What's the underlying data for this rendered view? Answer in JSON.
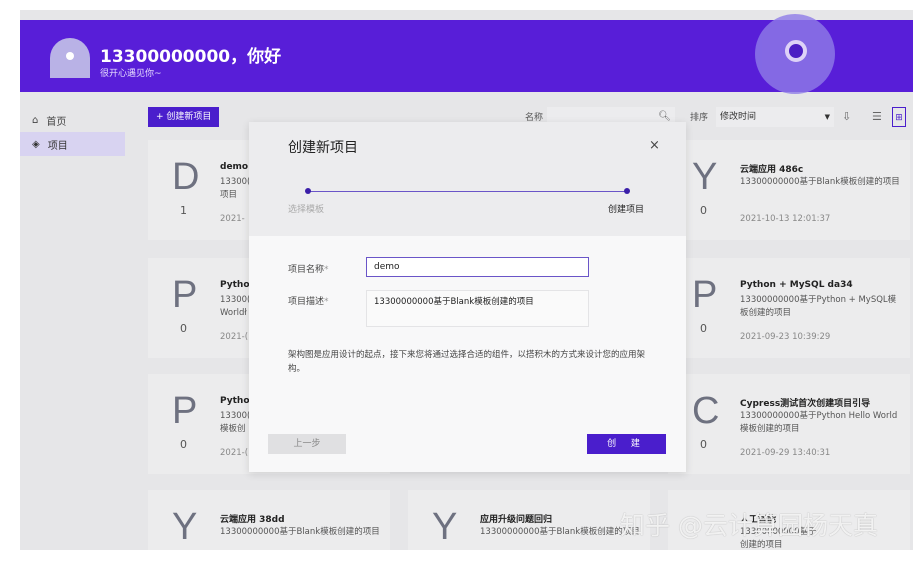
{
  "header": {
    "greeting": "13300000000，你好",
    "subtitle": "很开心遇见你~"
  },
  "sidebar": {
    "items": [
      {
        "label": "首页",
        "icon": "home-icon"
      },
      {
        "label": "项目",
        "icon": "layers-icon",
        "active": true
      }
    ]
  },
  "toolbar": {
    "create_label": "+ 创建新项目",
    "name_label": "名称",
    "search_value": "",
    "sort_label": "排序",
    "sort_value": "修改时间",
    "accent": "#4a1ecc"
  },
  "cards": [
    {
      "letter": "D",
      "count": "1",
      "title": "demo",
      "desc": "13300(\n项目",
      "date": "2021-"
    },
    {
      "letter": "Y",
      "count": "0",
      "title": "云端应用 486c",
      "desc": "13300000000基于Blank模板创建的项目",
      "date": "2021-10-13 12:01:37"
    },
    {
      "letter": "P",
      "count": "0",
      "title": "Pythor",
      "desc": "13300(\nWorldł",
      "date": "2021-("
    },
    {
      "letter": "P",
      "count": "0",
      "title": "Python + MySQL da34",
      "desc": "13300000000基于Python + MySQL模板创建的项目",
      "date": "2021-09-23 10:39:29"
    },
    {
      "letter": "P",
      "count": "0",
      "title": "Pythor",
      "desc": "13300(\n模板创",
      "date": "2021-("
    },
    {
      "letter": "C",
      "count": "0",
      "title": "Cypress测试首次创建项目引导",
      "desc": "13300000000基于Python Hello World模板创建的项目",
      "date": "2021-09-29 13:40:31"
    },
    {
      "letter": "Y",
      "count": "",
      "title": "云端应用 38dd",
      "desc": "13300000000基于Blank模板创建的项目",
      "date": ""
    },
    {
      "letter": "Y",
      "count": "",
      "title": "应用升级问题回归",
      "desc": "13300000000基于Blank模板创建的项目",
      "date": ""
    },
    {
      "letter": "",
      "count": "",
      "title": "人工智能",
      "desc": "13300000000基于\n创建的项目",
      "date": ""
    }
  ],
  "modal": {
    "title": "创建新项目",
    "close": "×",
    "steps": [
      "选择模板",
      "创建项目"
    ],
    "name_label": "项目名称",
    "desc_label": "项目描述",
    "required": "*",
    "name_value": "demo",
    "desc_value": "13300000000基于Blank模板创建的项目",
    "note": "架构图是应用设计的起点，接下来您将通过选择合适的组件，以搭积木的方式来设计您的应用架构。",
    "prev_label": "上一步",
    "create_label": "创 建"
  },
  "watermark": "知乎 @云计算园杨天真"
}
